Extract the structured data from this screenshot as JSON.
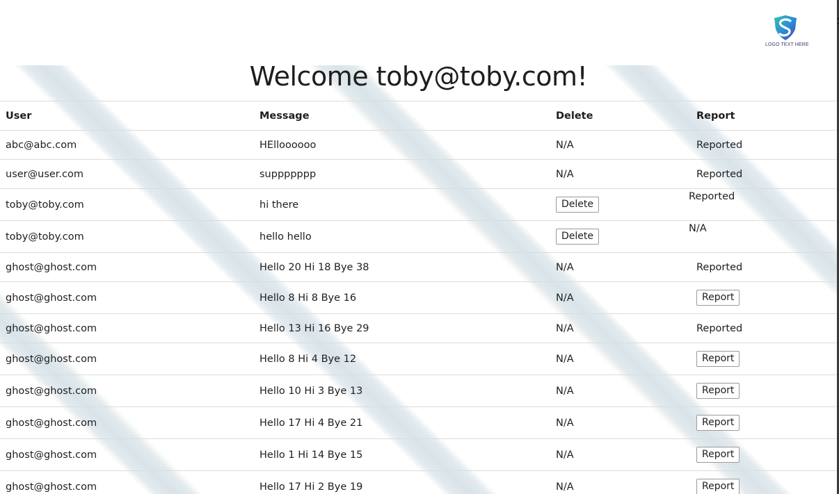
{
  "logo": {
    "text": "LOGO TEXT HERE",
    "icon": "shield-s-logo-icon"
  },
  "title": "Welcome toby@toby.com!",
  "table": {
    "headers": [
      "User",
      "Message",
      "Delete",
      "Report"
    ],
    "rows": [
      {
        "user": "abc@abc.com",
        "message": "HElloooooo",
        "delete": "N/A",
        "report": "Reported"
      },
      {
        "user": "user@user.com",
        "message": "suppppppp",
        "delete": "N/A",
        "report": "Reported"
      },
      {
        "user": "toby@toby.com",
        "message": "hi there",
        "delete": "Delete",
        "report": "Reported"
      },
      {
        "user": "toby@toby.com",
        "message": "hello hello",
        "delete": "Delete",
        "report": "N/A"
      },
      {
        "user": "ghost@ghost.com",
        "message": "Hello 20 Hi 18 Bye 38",
        "delete": "N/A",
        "report": "Reported"
      },
      {
        "user": "ghost@ghost.com",
        "message": "Hello 8 Hi 8 Bye 16",
        "delete": "N/A",
        "report": "Report"
      },
      {
        "user": "ghost@ghost.com",
        "message": "Hello 13 Hi 16 Bye 29",
        "delete": "N/A",
        "report": "Reported"
      },
      {
        "user": "ghost@ghost.com",
        "message": "Hello 8 Hi 4 Bye 12",
        "delete": "N/A",
        "report": "Report"
      },
      {
        "user": "ghost@ghost.com",
        "message": "Hello 10 Hi 3 Bye 13",
        "delete": "N/A",
        "report": "Report"
      },
      {
        "user": "ghost@ghost.com",
        "message": "Hello 17 Hi 4 Bye 21",
        "delete": "N/A",
        "report": "Report"
      },
      {
        "user": "ghost@ghost.com",
        "message": "Hello 1 Hi 14 Bye 15",
        "delete": "N/A",
        "report": "Report"
      },
      {
        "user": "ghost@ghost.com",
        "message": "Hello 17 Hi 2 Bye 19",
        "delete": "N/A",
        "report": "Report"
      }
    ]
  }
}
